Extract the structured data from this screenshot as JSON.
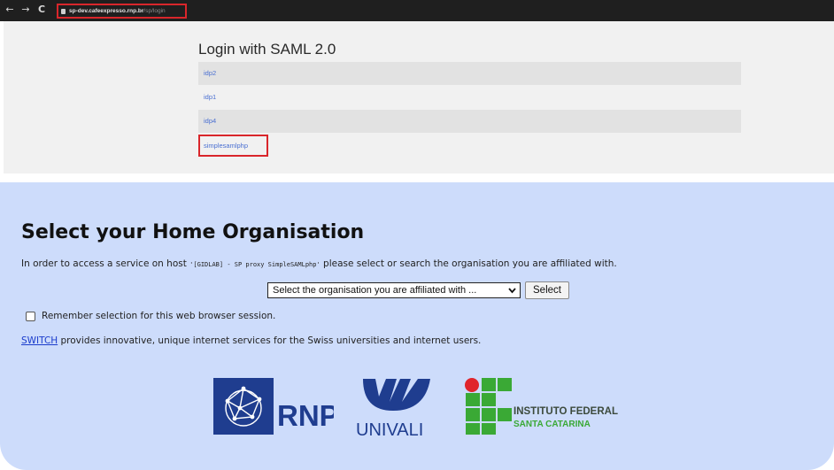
{
  "browser": {
    "back": "←",
    "forward": "→",
    "reload": "C",
    "url_host": "sp-dev.cafeexpresso.rnp.br",
    "url_path": "/sp/login"
  },
  "saml": {
    "title": "Login with SAML 2.0",
    "idps": [
      "idp2",
      "idp1",
      "idp4",
      "simplesamlphp"
    ]
  },
  "discovery": {
    "title": "Select your Home Organisation",
    "intro_before": "In order to access a service on host ",
    "intro_host": "'[GIDLAB] - SP proxy SimpleSAMLphp'",
    "intro_after": " please select or search the organisation you are affiliated with.",
    "select_value": "Select the organisation you are affiliated with ...",
    "select_button": "Select",
    "remember_label": "Remember selection for this web browser session.",
    "switch_link": "SWITCH",
    "switch_text": " provides innovative, unique internet services for the Swiss universities and internet users."
  },
  "logos": {
    "rnp": "RNP",
    "univali": "UNIVALI",
    "if_line1": "INSTITUTO FEDERAL",
    "if_line2": "SANTA CATARINA"
  },
  "colors": {
    "highlight": "#d9262b",
    "link": "#4a6fd1",
    "panel": "#cddcfb",
    "rnp_blue": "#1f3d8f",
    "univali_blue": "#1f3d8f",
    "if_green": "#3aa935",
    "if_red": "#e0252c"
  }
}
